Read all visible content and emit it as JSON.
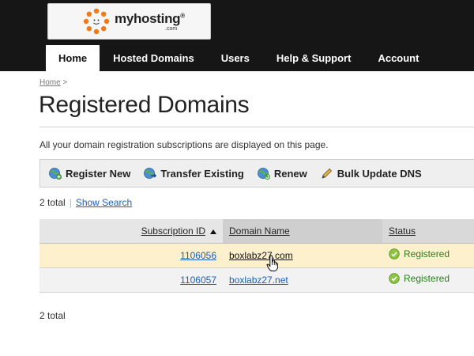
{
  "brand": {
    "name": "myhosting",
    "registered_mark": "®",
    "tld": ".com",
    "colors": {
      "orange": "#f07a1a",
      "header_bg": "#161616"
    }
  },
  "nav": {
    "items": [
      {
        "label": "Home",
        "active": true
      },
      {
        "label": "Hosted Domains",
        "active": false
      },
      {
        "label": "Users",
        "active": false
      },
      {
        "label": "Help & Support",
        "active": false
      },
      {
        "label": "Account",
        "active": false
      }
    ]
  },
  "breadcrumb": {
    "home": "Home",
    "separator": ">"
  },
  "page": {
    "title": "Registered Domains",
    "intro": "All your domain registration subscriptions are displayed on this page."
  },
  "toolbar": {
    "register_new": {
      "label": "Register New",
      "icon": "globe-plus-icon"
    },
    "transfer_existing": {
      "label": "Transfer Existing",
      "icon": "globe-transfer-icon"
    },
    "renew": {
      "label": "Renew",
      "icon": "globe-renew-icon"
    },
    "bulk_update_dns": {
      "label": "Bulk Update DNS",
      "icon": "pencil-icon"
    }
  },
  "summary": {
    "total_text": "2 total",
    "show_search": "Show Search",
    "separator": "|"
  },
  "table": {
    "columns": [
      "Subscription ID",
      "Domain Name",
      "Status"
    ],
    "sort": {
      "column": "Subscription ID",
      "direction": "ascending"
    },
    "rows": [
      {
        "subscription_id": "1106056",
        "domain": "boxlabz27.com",
        "status": "Registered",
        "highlighted": true
      },
      {
        "subscription_id": "1106057",
        "domain": "boxlabz27.net",
        "status": "Registered",
        "highlighted": false
      }
    ]
  },
  "footer": {
    "total_text": "2 total"
  }
}
